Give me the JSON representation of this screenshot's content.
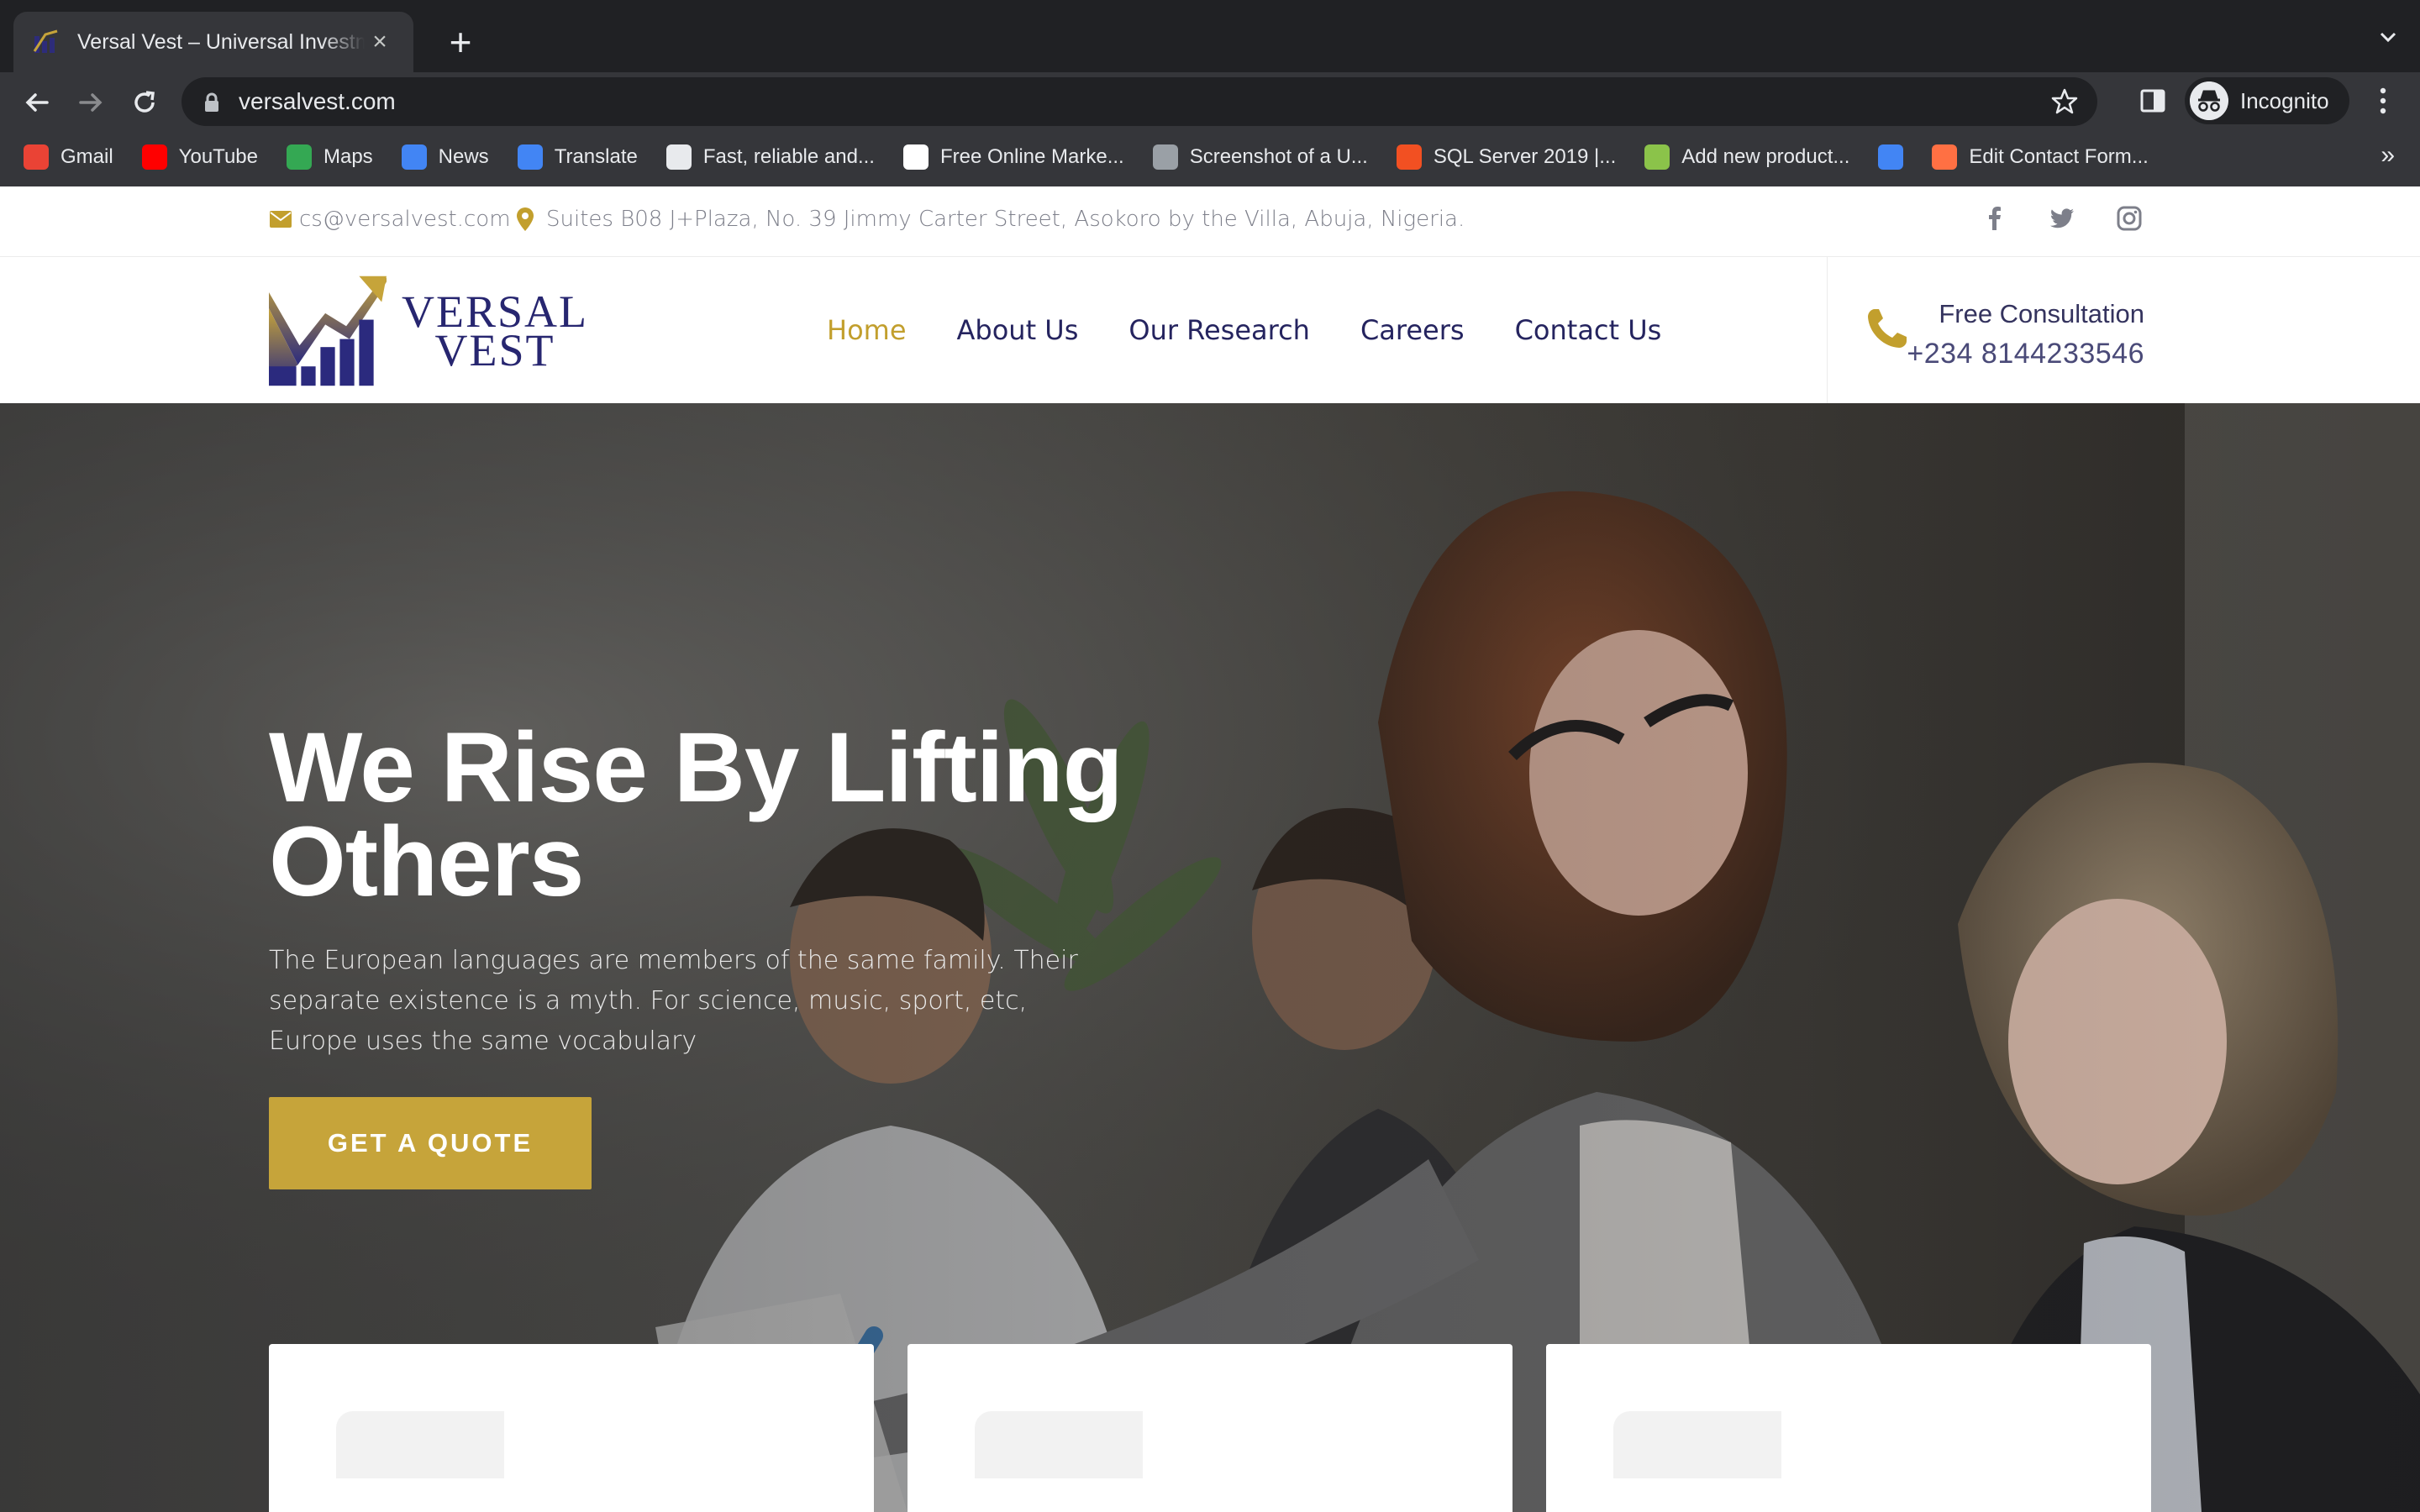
{
  "browser": {
    "tab_title": "Versal Vest – Universal Investm",
    "tab_close": "×",
    "new_tab": "+",
    "url": "versalvest.com",
    "profile_label": "Incognito",
    "bookmarks": [
      {
        "label": "Gmail",
        "icon": "gmail-icon",
        "color": "#ea4335"
      },
      {
        "label": "YouTube",
        "icon": "youtube-icon",
        "color": "#ff0000"
      },
      {
        "label": "Maps",
        "icon": "maps-icon",
        "color": "#34a853"
      },
      {
        "label": "News",
        "icon": "news-icon",
        "color": "#4285f4"
      },
      {
        "label": "Translate",
        "icon": "translate-icon",
        "color": "#4285f4"
      },
      {
        "label": "Fast, reliable and...",
        "icon": "at-icon",
        "color": "#e8eaed"
      },
      {
        "label": "Free Online Marke...",
        "icon": "google-icon",
        "color": "#ffffff"
      },
      {
        "label": "Screenshot of a U...",
        "icon": "globe-icon",
        "color": "#9aa0a6"
      },
      {
        "label": "SQL Server 2019 |...",
        "icon": "microsoft-icon",
        "color": "#f25022"
      },
      {
        "label": "Add new product...",
        "icon": "product-icon",
        "color": "#8bc34a"
      },
      {
        "label": "",
        "icon": "docs-icon",
        "color": "#4285f4"
      },
      {
        "label": "Edit Contact Form...",
        "icon": "form-icon",
        "color": "#ff7043"
      }
    ],
    "bookmarks_more": "»"
  },
  "site": {
    "topbar": {
      "email": "cs@versalvest.com",
      "address": "Suites B08 J+Plaza, No. 39 Jimmy Carter Street, Asokoro by the Villa, Abuja, Nigeria."
    },
    "logo": {
      "line1": "VERSAL",
      "line2": "VEST"
    },
    "nav": [
      "Home",
      "About Us",
      "Our Research",
      "Careers",
      "Contact Us"
    ],
    "active_nav": "Home",
    "consultation": {
      "label": "Free Consultation",
      "phone": "+234 8144233546"
    },
    "hero": {
      "title": "We Rise By Lifting Others",
      "text": "The European languages are members of the same family. Their separate existence is a myth. For science, music, sport, etc, Europe uses the same vocabulary",
      "cta": "GET A QUOTE"
    }
  },
  "colors": {
    "gold": "#c6a43a",
    "navy": "#25245f",
    "chrome_dark": "#202124",
    "chrome": "#35363a"
  }
}
